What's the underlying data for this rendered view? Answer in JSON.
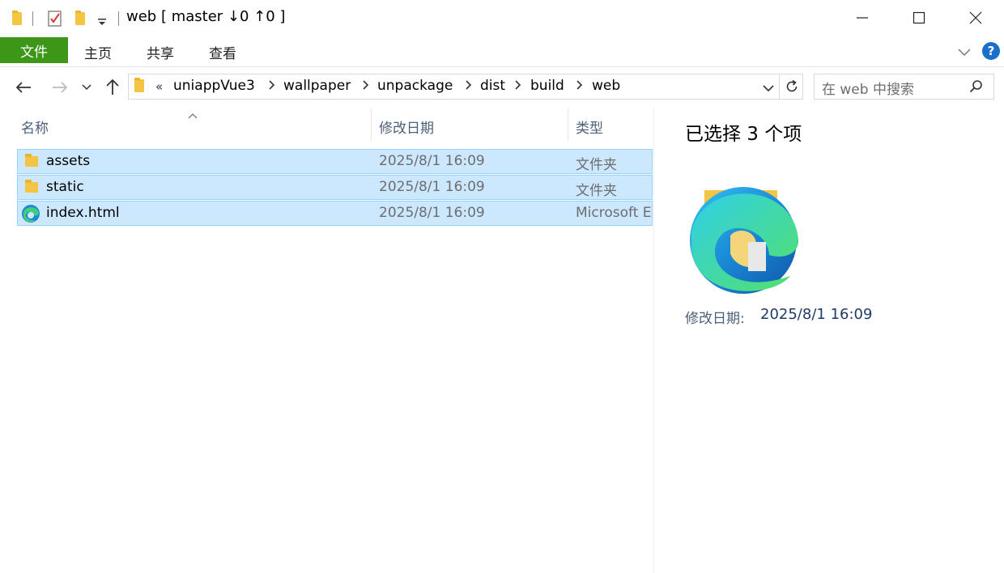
{
  "window": {
    "title": "web [ master ↓0 ↑0 ]",
    "controls": {
      "minimize": "minimize",
      "maximize": "maximize",
      "close": "close"
    }
  },
  "ribbon": {
    "tabs": [
      {
        "label": "文件",
        "active": true
      },
      {
        "label": "主页"
      },
      {
        "label": "共享"
      },
      {
        "label": "查看"
      }
    ],
    "accent": "#3e9619"
  },
  "navigation": {
    "breadcrumbs": [
      "uniappVue3",
      "wallpaper",
      "unpackage",
      "dist",
      "build",
      "web"
    ],
    "overflow_glyph": "«",
    "search_placeholder": "在 web 中搜索"
  },
  "columns": [
    {
      "label": "名称"
    },
    {
      "label": "修改日期"
    },
    {
      "label": "类型"
    }
  ],
  "files": [
    {
      "name": "assets",
      "modified": "2025/8/1 16:09",
      "type": "文件夹",
      "icon": "folder-icon"
    },
    {
      "name": "static",
      "modified": "2025/8/1 16:09",
      "type": "文件夹",
      "icon": "folder-icon"
    },
    {
      "name": "index.html",
      "modified": "2025/8/1 16:09",
      "type": "Microsoft E",
      "icon": "edge-icon"
    }
  ],
  "details": {
    "title": "已选择 3 个项",
    "modified_label": "修改日期:",
    "modified_value": "2025/8/1 16:09"
  },
  "colors": {
    "selection_bg": "#cce8ff",
    "selection_border": "#99d1ff",
    "header_text": "#4c607a",
    "link_blue": "#1f3b68"
  }
}
